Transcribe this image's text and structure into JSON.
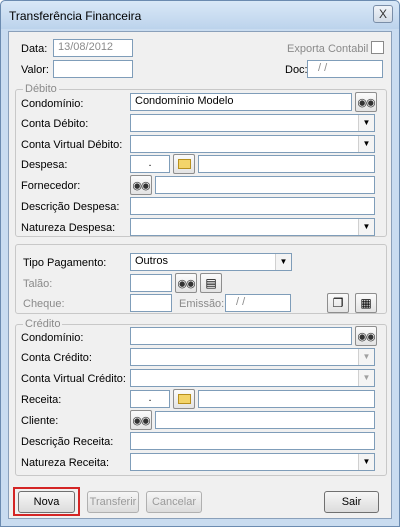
{
  "window": {
    "title": "Transferência Financeira",
    "close_label": "X"
  },
  "header": {
    "data_label": "Data:",
    "data_value": "13/08/2012",
    "valor_label": "Valor:",
    "valor_value": "",
    "exporta_label": "Exporta Contabil",
    "doc_label": "Doc:",
    "doc_value": "/ /"
  },
  "debito": {
    "title": "Débito",
    "condominio_label": "Condomínio:",
    "condominio_value": "Condomínio Modelo",
    "conta_label": "Conta Débito:",
    "conta_value": "",
    "conta_virtual_label": "Conta Virtual Débito:",
    "conta_virtual_value": "",
    "despesa_label": "Despesa:",
    "despesa_code": ".",
    "despesa_desc": "",
    "fornecedor_label": "Fornecedor:",
    "fornecedor_value": "",
    "descricao_label": "Descrição Despesa:",
    "descricao_value": "",
    "natureza_label": "Natureza Despesa:",
    "natureza_value": ""
  },
  "pagamento": {
    "tipo_label": "Tipo Pagamento:",
    "tipo_value": "Outros",
    "talao_label": "Talão:",
    "talao_value": "",
    "cheque_label": "Cheque:",
    "cheque_value": "",
    "emissao_label": "Emissão:",
    "emissao_value": "/ /"
  },
  "credito": {
    "title": "Crédito",
    "condominio_label": "Condomínio:",
    "condominio_value": "",
    "conta_label": "Conta Crédito:",
    "conta_value": "",
    "conta_virtual_label": "Conta Virtual Crédito:",
    "conta_virtual_value": "",
    "receita_label": "Receita:",
    "receita_code": ".",
    "receita_desc": "",
    "cliente_label": "Cliente:",
    "cliente_value": "",
    "descricao_label": "Descrição Receita:",
    "descricao_value": "",
    "natureza_label": "Natureza Receita:",
    "natureza_value": ""
  },
  "buttons": {
    "nova": "Nova",
    "transferir": "Transferir",
    "cancelar": "Cancelar",
    "sair": "Sair"
  },
  "colors": {
    "highlight": "#d42525"
  }
}
